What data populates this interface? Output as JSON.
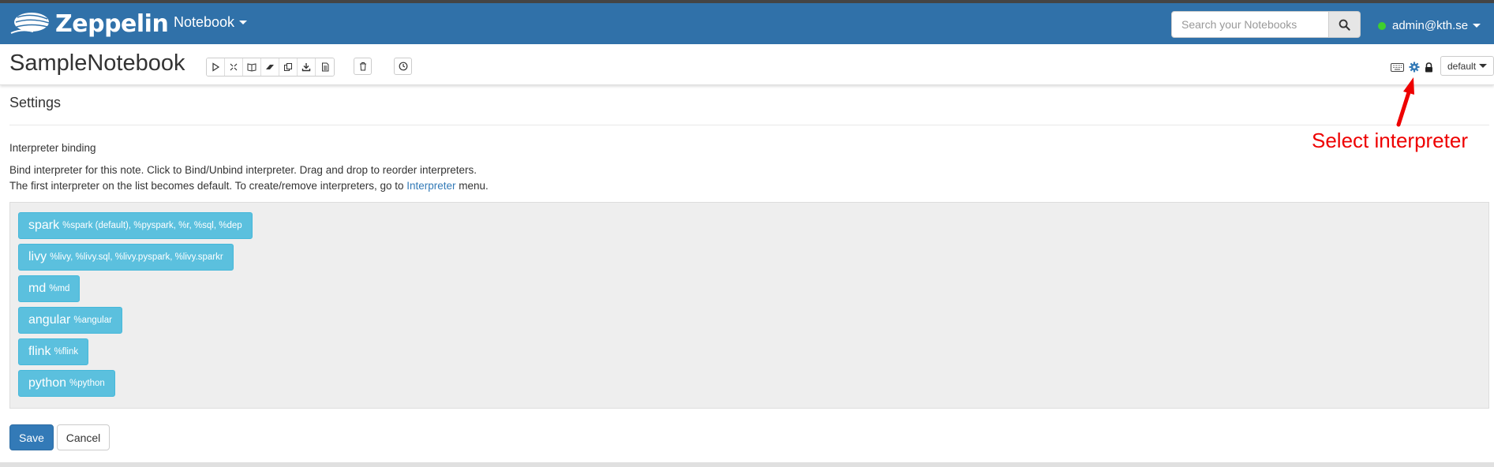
{
  "navbar": {
    "brand": "Zeppelin",
    "menu_label": "Notebook",
    "search_placeholder": "Search your Notebooks",
    "user_label": "admin@kth.se"
  },
  "notebook": {
    "title": "SampleNotebook",
    "toolbar": {
      "group1_icons": [
        "run-all-icon",
        "hide-code-icon",
        "hide-output-icon",
        "clear-output-icon",
        "clone-icon",
        "export-icon",
        "version-control-icon"
      ],
      "delete_icon": "trash-icon",
      "schedule_icon": "clock-icon"
    },
    "right_controls": {
      "shortcut_icon": "keyboard-icon",
      "settings_icon": "gear-icon",
      "lock_icon": "lock-icon",
      "mode_label": "default"
    }
  },
  "settings": {
    "title": "Settings",
    "binding_heading": "Interpreter binding",
    "desc_line1": "Bind interpreter for this note. Click to Bind/Unbind interpreter. Drag and drop to reorder interpreters.",
    "desc_line2_before": "The first interpreter on the list becomes default. To create/remove interpreters, go to ",
    "desc_line2_link": "Interpreter",
    "desc_line2_after": " menu.",
    "interpreters": [
      {
        "name": "spark",
        "aliases": "%spark (default), %pyspark, %r, %sql, %dep"
      },
      {
        "name": "livy",
        "aliases": "%livy, %livy.sql, %livy.pyspark, %livy.sparkr"
      },
      {
        "name": "md",
        "aliases": "%md"
      },
      {
        "name": "angular",
        "aliases": "%angular"
      },
      {
        "name": "flink",
        "aliases": "%flink"
      },
      {
        "name": "python",
        "aliases": "%python"
      }
    ],
    "save_label": "Save",
    "cancel_label": "Cancel"
  },
  "annotation": {
    "text": "Select interpreter"
  },
  "colors": {
    "navbar": "#3071a9",
    "interpreter_button": "#5bc0de",
    "primary_button": "#337ab7",
    "annotation": "#ee0000",
    "status_online": "#3ecf2e"
  }
}
